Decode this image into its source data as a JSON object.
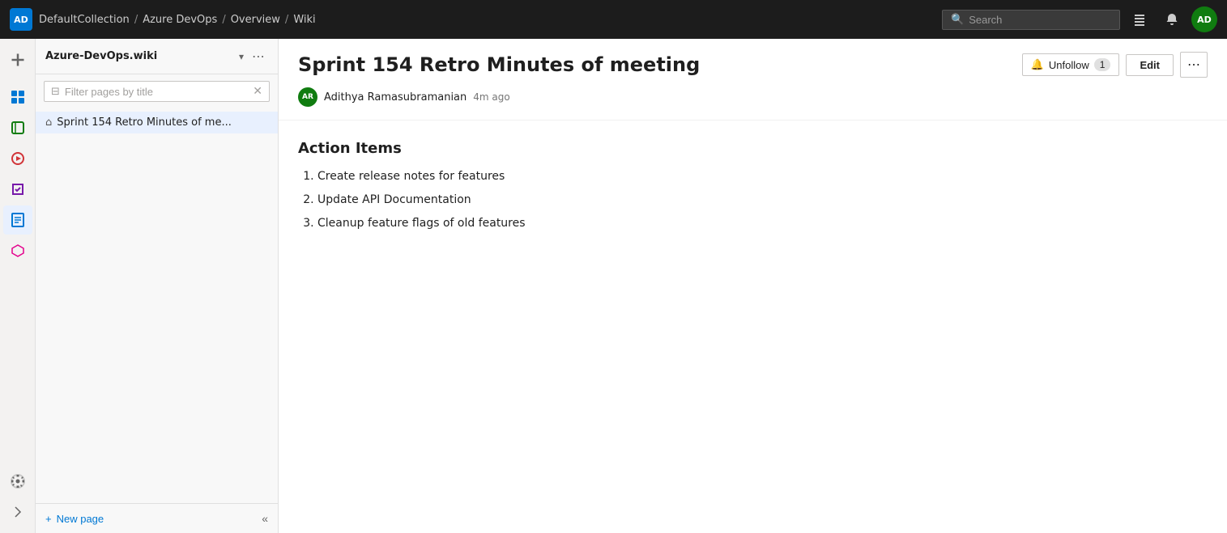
{
  "topbar": {
    "logo": "AD",
    "breadcrumb": [
      {
        "label": "DefaultCollection",
        "href": "#"
      },
      {
        "label": "Azure DevOps",
        "href": "#"
      },
      {
        "label": "Overview",
        "href": "#"
      },
      {
        "label": "Wiki",
        "href": "#"
      }
    ],
    "search_placeholder": "Search",
    "user_initials": "AD"
  },
  "sidebar": {
    "wiki_name": "Azure-DevOps.wiki",
    "filter_placeholder": "Filter pages by title",
    "tree_item": "Sprint 154 Retro Minutes of me...",
    "new_page_label": "New page"
  },
  "page": {
    "title": "Sprint 154 Retro Minutes of meeting",
    "author_initials": "AR",
    "author_name": "Adithya Ramasubramanian",
    "time_ago": "4m ago",
    "unfollow_label": "Unfollow",
    "follow_count": "1",
    "edit_label": "Edit",
    "section_heading": "Action Items",
    "action_items": [
      "Create release notes for features",
      "Update API Documentation",
      "Cleanup feature flags of old features"
    ]
  },
  "icons": {
    "search": "🔍",
    "grid": "⊞",
    "briefcase": "💼",
    "filter": "⊟",
    "home": "⌂",
    "chevron_down": "⌄",
    "more": "•••",
    "close": "✕",
    "plus": "+",
    "collapse": "«",
    "unfollow_bell": "🔔",
    "gear": "⚙"
  }
}
